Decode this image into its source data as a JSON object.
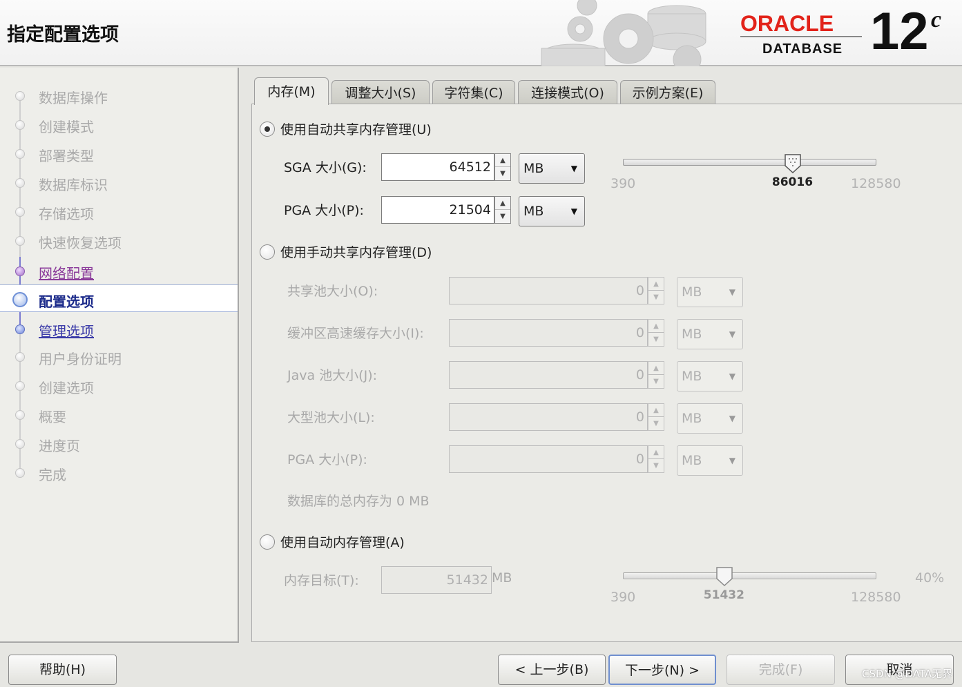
{
  "header": {
    "title": "指定配置选项",
    "logo": {
      "brand": "ORACLE",
      "product": "DATABASE",
      "version": "12",
      "version_suffix": "c"
    }
  },
  "nav": {
    "items": [
      {
        "label": "数据库操作",
        "state": "disabled"
      },
      {
        "label": "创建模式",
        "state": "disabled"
      },
      {
        "label": "部署类型",
        "state": "disabled"
      },
      {
        "label": "数据库标识",
        "state": "disabled"
      },
      {
        "label": "存储选项",
        "state": "disabled"
      },
      {
        "label": "快速恢复选项",
        "state": "disabled"
      },
      {
        "label": "网络配置",
        "state": "visited"
      },
      {
        "label": "配置选项",
        "state": "current"
      },
      {
        "label": "管理选项",
        "state": "link"
      },
      {
        "label": "用户身份证明",
        "state": "disabled"
      },
      {
        "label": "创建选项",
        "state": "disabled"
      },
      {
        "label": "概要",
        "state": "disabled"
      },
      {
        "label": "进度页",
        "state": "disabled"
      },
      {
        "label": "完成",
        "state": "disabled"
      }
    ]
  },
  "tabs": [
    {
      "label": "内存(M)",
      "active": true
    },
    {
      "label": "调整大小(S)"
    },
    {
      "label": "字符集(C)"
    },
    {
      "label": "连接模式(O)"
    },
    {
      "label": "示例方案(E)"
    }
  ],
  "auto_shared": {
    "radio_label": "使用自动共享内存管理(U)",
    "selected": true,
    "sga_label": "SGA 大小(G):",
    "sga_value": "64512",
    "sga_unit": "MB",
    "pga_label": "PGA 大小(P):",
    "pga_value": "21504",
    "pga_unit": "MB",
    "slider": {
      "min": "390",
      "max": "128580",
      "value": "86016",
      "fraction": 0.67
    }
  },
  "manual_shared": {
    "radio_label": "使用手动共享内存管理(D)",
    "selected": false,
    "fields": [
      {
        "label": "共享池大小(O):",
        "value": "0",
        "unit": "MB"
      },
      {
        "label": "缓冲区高速缓存大小(I):",
        "value": "0",
        "unit": "MB"
      },
      {
        "label": "Java 池大小(J):",
        "value": "0",
        "unit": "MB"
      },
      {
        "label": "大型池大小(L):",
        "value": "0",
        "unit": "MB"
      },
      {
        "label": "PGA 大小(P):",
        "value": "0",
        "unit": "MB"
      }
    ],
    "total_text": "数据库的总内存为 0 MB"
  },
  "auto_memory": {
    "radio_label": "使用自动内存管理(A)",
    "selected": false,
    "target_label": "内存目标(T):",
    "target_value": "51432",
    "target_unit": "MB",
    "slider": {
      "min": "390",
      "max": "128580",
      "value": "51432",
      "percent": "40%",
      "fraction": 0.4
    }
  },
  "footer": {
    "help": "帮助(H)",
    "back": "< 上一步(B)",
    "next": "下一步(N) >",
    "finish": "完成(F)",
    "cancel": "取消"
  },
  "watermark": "CSDN @DATA无界"
}
